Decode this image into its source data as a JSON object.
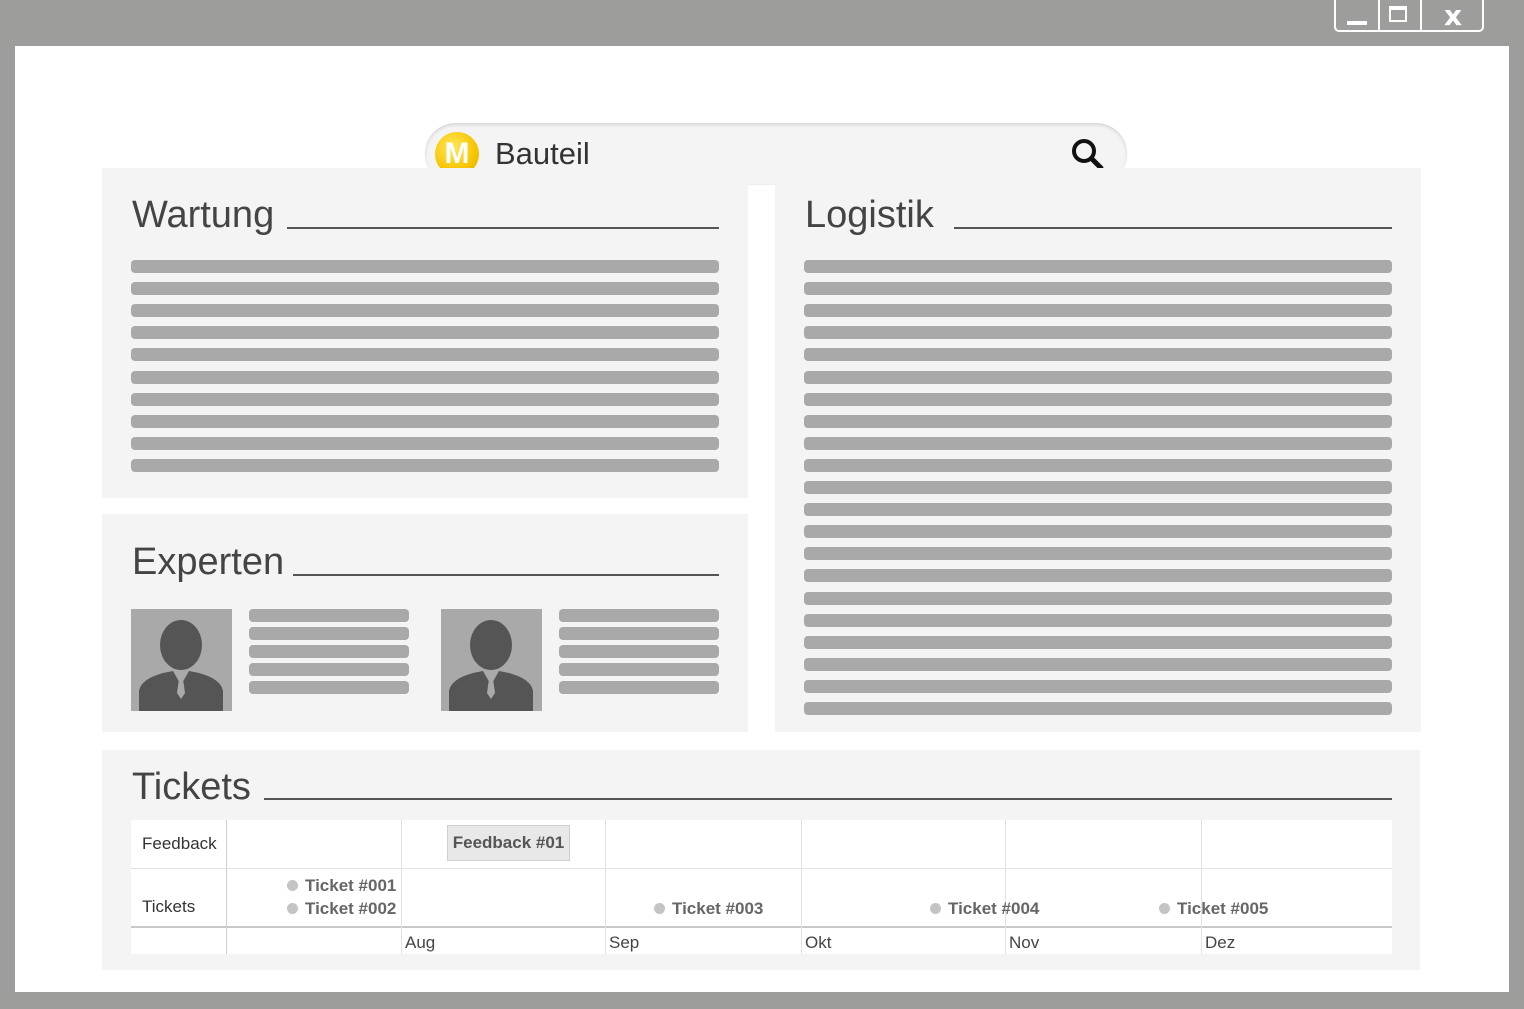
{
  "window": {
    "controls": {
      "minimize_icon": "minimize-icon",
      "maximize_icon": "maximize-icon",
      "close_label": "x"
    }
  },
  "search": {
    "value": "Bauteil",
    "logo_letter": "M",
    "logo_icon": "m-logo-icon",
    "search_icon": "magnifier-icon"
  },
  "panels": {
    "wartung": {
      "title": "Wartung"
    },
    "logistik": {
      "title": "Logistik"
    },
    "experten": {
      "title": "Experten",
      "avatar_icon": "person-silhouette-icon"
    },
    "tickets": {
      "title": "Tickets"
    }
  },
  "timeline": {
    "rows": [
      "Feedback",
      "Tickets"
    ],
    "months": [
      "Aug",
      "Sep",
      "Okt",
      "Nov",
      "Dez"
    ],
    "feedback_items": [
      "Feedback #01"
    ],
    "ticket_items": [
      "Ticket #001",
      "Ticket #002",
      "Ticket #003",
      "Ticket #004",
      "Ticket #005"
    ]
  },
  "colors": {
    "frame": "#9d9d9c",
    "panel": "#f4f4f4",
    "placeholder_line": "#a9a9a9",
    "logo_yellow": "#f6c400"
  }
}
